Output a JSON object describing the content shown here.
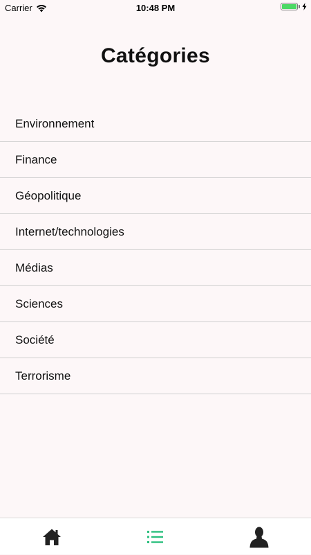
{
  "status_bar": {
    "carrier": "Carrier",
    "time": "10:48 PM"
  },
  "title": "Catégories",
  "categories": [
    "Environnement",
    "Finance",
    "Géopolitique",
    "Internet/technologies",
    "Médias",
    "Sciences",
    "Société",
    "Terrorisme"
  ],
  "tab_bar": {
    "tabs": [
      {
        "icon": "home-icon",
        "active": false
      },
      {
        "icon": "list-icon",
        "active": true
      },
      {
        "icon": "profile-icon",
        "active": false
      }
    ]
  },
  "colors": {
    "background": "#fdf7f8",
    "accent": "#2bbf7e",
    "icon": "#222222",
    "battery": "#4cd964"
  }
}
